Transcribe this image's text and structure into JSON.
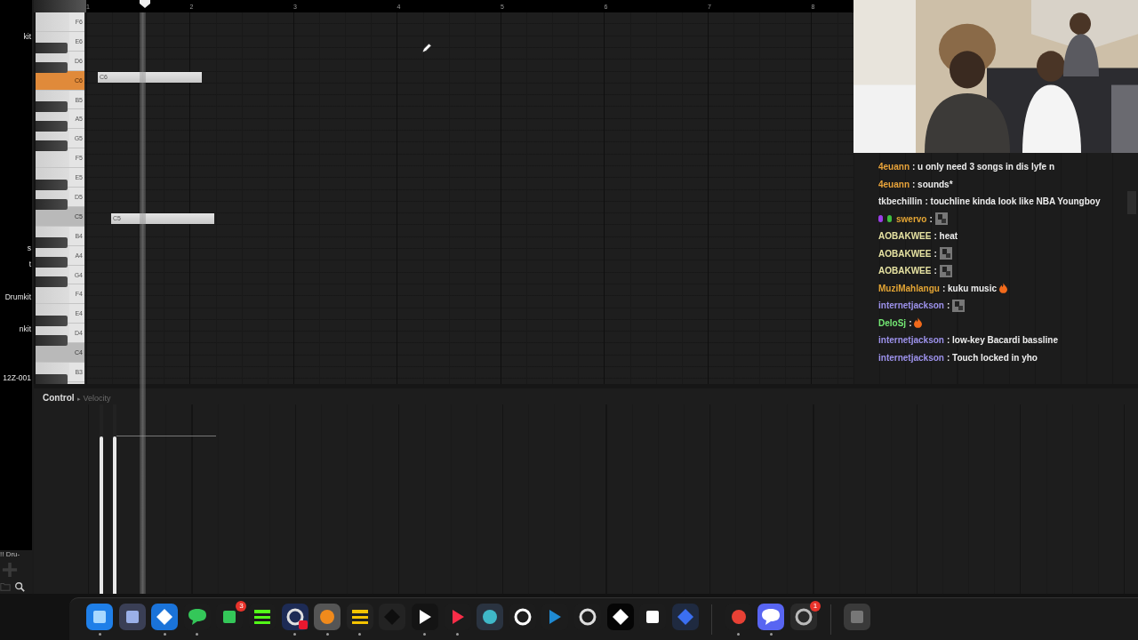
{
  "sidebar": {
    "items": [
      {
        "label": "kit"
      },
      {
        "label": "s"
      },
      {
        "label": "t"
      },
      {
        "label": "Drumkit"
      },
      {
        "label": "nkit"
      },
      {
        "label": "12Z-001"
      }
    ],
    "panel_label": "!! Dru-"
  },
  "ruler": [
    "1",
    "2",
    "3",
    "4",
    "5",
    "6",
    "7",
    "8"
  ],
  "piano_keys": [
    {
      "label": "F6",
      "selected": false,
      "shaded": false
    },
    {
      "label": "E6",
      "selected": false,
      "shaded": false
    },
    {
      "label": "D6",
      "selected": false,
      "shaded": false
    },
    {
      "label": "C6",
      "selected": true,
      "shaded": false
    },
    {
      "label": "B5",
      "selected": false,
      "shaded": false
    },
    {
      "label": "A5",
      "selected": false,
      "shaded": false
    },
    {
      "label": "G5",
      "selected": false,
      "shaded": false
    },
    {
      "label": "F5",
      "selected": false,
      "shaded": false
    },
    {
      "label": "E5",
      "selected": false,
      "shaded": false
    },
    {
      "label": "D5",
      "selected": false,
      "shaded": false
    },
    {
      "label": "C5",
      "selected": false,
      "shaded": true
    },
    {
      "label": "B4",
      "selected": false,
      "shaded": false
    },
    {
      "label": "A4",
      "selected": false,
      "shaded": false
    },
    {
      "label": "G4",
      "selected": false,
      "shaded": false
    },
    {
      "label": "F4",
      "selected": false,
      "shaded": false
    },
    {
      "label": "E4",
      "selected": false,
      "shaded": false
    },
    {
      "label": "D4",
      "selected": false,
      "shaded": false
    },
    {
      "label": "C4",
      "selected": false,
      "shaded": true
    },
    {
      "label": "B3",
      "selected": false,
      "shaded": false
    }
  ],
  "notes": [
    {
      "label": "C6",
      "level": 0.83
    },
    {
      "label": "C5",
      "level": 0.83
    }
  ],
  "control": {
    "label": "Control",
    "caret": "▸",
    "parameter": "Velocity"
  },
  "chat": [
    {
      "kind": "text",
      "user": "4euann",
      "color": "#e8a33a",
      "text": ": u only need 3 songs in dis lyfe n"
    },
    {
      "kind": "text",
      "user": "4euann",
      "color": "#e8a33a",
      "text": ": sounds*"
    },
    {
      "kind": "text",
      "user": "tkbechillin",
      "color": "#e6e6e6",
      "text": ": touchline kinda look like NBA Youngboy"
    },
    {
      "kind": "emote",
      "user": "swervo",
      "color": "#e4a534",
      "badges": [
        {
          "color": "#9b3ee8"
        },
        {
          "color": "#3fbf3f"
        }
      ],
      "text": ":"
    },
    {
      "kind": "text",
      "user": "AOBAKWEE",
      "color": "#e6e2a2",
      "text": ": heat"
    },
    {
      "kind": "emote",
      "user": "AOBAKWEE",
      "color": "#e6e2a2",
      "text": ":"
    },
    {
      "kind": "emote",
      "user": "AOBAKWEE",
      "color": "#e6e2a2",
      "text": ":"
    },
    {
      "kind": "fire",
      "user": "MuziMahlangu",
      "color": "#e4a534",
      "text": ": kuku music"
    },
    {
      "kind": "emote",
      "user": "internetjackson",
      "color": "#9d92ec",
      "text": ":"
    },
    {
      "kind": "fire",
      "user": "DeloSj",
      "color": "#74e874",
      "text": ":"
    },
    {
      "kind": "text",
      "user": "internetjackson",
      "color": "#9d92ec",
      "text": ": low-key Bacardi bassline"
    },
    {
      "kind": "text",
      "user": "internetjackson",
      "color": "#9d92ec",
      "text": ": Touch locked in yho"
    }
  ],
  "dock": [
    {
      "kind": "finder",
      "running": true
    },
    {
      "kind": "files",
      "running": false
    },
    {
      "kind": "safari",
      "running": true
    },
    {
      "kind": "messages",
      "running": true
    },
    {
      "kind": "facetime",
      "running": false,
      "badge": "3"
    },
    {
      "kind": "kick",
      "running": false
    },
    {
      "kind": "obs",
      "running": true
    },
    {
      "kind": "fl",
      "running": true
    },
    {
      "kind": "notes",
      "running": true
    },
    {
      "kind": "dark",
      "running": false
    },
    {
      "kind": "tradingview",
      "running": true
    },
    {
      "kind": "music",
      "running": true
    },
    {
      "kind": "davinci",
      "running": false
    },
    {
      "kind": "github",
      "running": false
    },
    {
      "kind": "vscode",
      "running": false
    },
    {
      "kind": "chatgpt",
      "running": false
    },
    {
      "kind": "capcut",
      "running": false
    },
    {
      "kind": "notion",
      "running": false
    },
    {
      "kind": "roblox",
      "running": false
    },
    {
      "kind": "separator"
    },
    {
      "kind": "chrome",
      "running": true
    },
    {
      "kind": "discord",
      "running": true
    },
    {
      "kind": "settings",
      "running": false,
      "badge": "1"
    },
    {
      "kind": "separator"
    },
    {
      "kind": "trash",
      "running": false
    }
  ]
}
